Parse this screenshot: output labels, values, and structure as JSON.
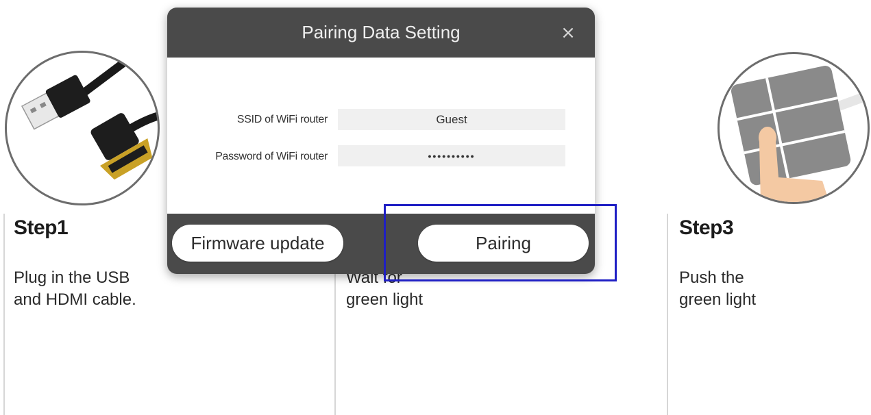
{
  "steps": [
    {
      "title": "Step1",
      "line1": "Plug in the USB",
      "line2": "and HDMI cable."
    },
    {
      "title": "",
      "line1": "Wait for",
      "line2": "green light"
    },
    {
      "title": "Step3",
      "line1": "Push the",
      "line2": "green light"
    }
  ],
  "dialog": {
    "title": "Pairing Data Setting",
    "close_label": "×",
    "ssid_label": "SSID of WiFi router",
    "ssid_value": "Guest",
    "password_label": "Password of WiFi router",
    "password_value": "••••••••••",
    "firmware_button": "Firmware update",
    "pairing_button": "Pairing"
  },
  "icons": {
    "step1": "usb-hdmi-cable-icon",
    "step3": "push-green-light-icon"
  },
  "colors": {
    "dialog_bg": "#4a4a4a",
    "highlight": "#1f1fc4"
  }
}
